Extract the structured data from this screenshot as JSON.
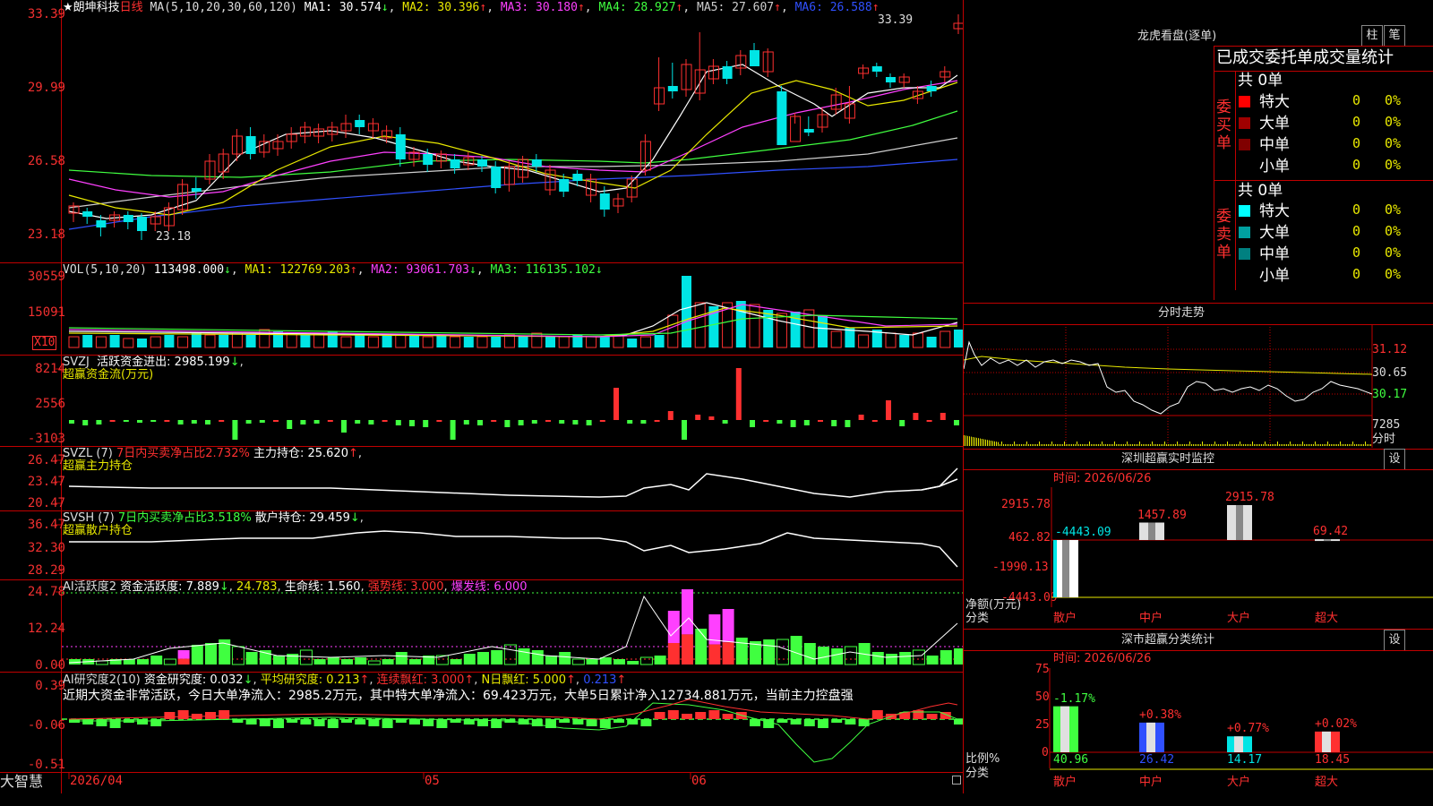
{
  "stock": {
    "name": "★朗坤科技",
    "period": "日线"
  },
  "ma": {
    "label": "MA(5,10,20,30,60,120)",
    "items": [
      {
        "text": "MA1: 30.574",
        "arrow": "↓",
        "color": "#ffffff"
      },
      {
        "text": "MA2: 30.396",
        "arrow": "↑",
        "color": "#e8e800"
      },
      {
        "text": "MA3: 30.180",
        "arrow": "↑",
        "color": "#ff40ff"
      },
      {
        "text": "MA4: 28.927",
        "arrow": "↑",
        "color": "#40ff40"
      },
      {
        "text": "MA5: 27.607",
        "arrow": "↑",
        "color": "#cfcfcf"
      },
      {
        "text": "MA6: 26.588",
        "arrow": "↑",
        "color": "#3050ff"
      }
    ],
    "high_label": "33.39",
    "low_label": "23.18"
  },
  "price_axis": [
    "33.39",
    "29.99",
    "26.58",
    "23.18"
  ],
  "vol": {
    "label": "VOL(5,10,20)",
    "value": "113498.000",
    "ma1": "MA1: 122769.203",
    "ma2": "MA2: 93061.703",
    "ma3": "MA3: 116135.102",
    "axis": [
      "30559",
      "15091"
    ],
    "unit": "X10"
  },
  "svzj": {
    "title": "SVZJ",
    "label": "活跃资金进出: 2985.199",
    "sub": "超赢资金流(万元)",
    "axis": [
      "8214",
      "2556",
      "-3103"
    ]
  },
  "svzl": {
    "title": "SVZL (7)",
    "pct": "7日内买卖净占比2.732%",
    "label": "主力持仓: 25.620",
    "sub": "超赢主力持仓",
    "axis": [
      "26.47",
      "23.47",
      "20.47"
    ]
  },
  "svsh": {
    "title": "SVSH (7)",
    "pct": "7日内买卖净占比3.518%",
    "label": "散户持仓: 29.459",
    "sub": "超赢散户持仓",
    "axis": [
      "36.47",
      "32.30",
      "28.29"
    ]
  },
  "ai_active": {
    "title": "AI活跃度2",
    "label": "资金活跃度: 7.889",
    "v2": "24.783",
    "life": "生命线: 1.560",
    "strong": "强势线: 3.000",
    "burst": "爆发线: 6.000",
    "axis": [
      "24.78",
      "12.24",
      "0.00"
    ]
  },
  "ai_research": {
    "title": "AI研究度2(10)",
    "label": "资金研究度: 0.032",
    "avg": "平均研究度: 0.213",
    "red": "连续飘红: 3.000",
    "nred": "N日飘红: 5.000",
    "last": "0.213",
    "summary": "近期大资金非常活跃，今日大单净流入：2985.2万元，其中特大单净流入：69.423万元，大单5日累计净入12734.881万元，当前主力控盘强",
    "axis": [
      "0.39",
      "-0.06",
      "-0.51"
    ]
  },
  "date_axis": [
    "2026/04",
    "05",
    "06"
  ],
  "brand": "大智慧",
  "panel": {
    "title": "龙虎看盘(逐单)",
    "btn1": "柱",
    "btn2": "笔",
    "header": "已成交委托单成交量统计",
    "buy_group": "委买单",
    "sell_group": "委卖单",
    "buy_total": "共 0单",
    "sell_total": "共 0单",
    "buy_rows": [
      {
        "label": "特大",
        "count": "0",
        "pct": "0%",
        "color": "#ff0000"
      },
      {
        "label": "大单",
        "count": "0",
        "pct": "0%",
        "color": "#a00000"
      },
      {
        "label": "中单",
        "count": "0",
        "pct": "0%",
        "color": "#800000"
      },
      {
        "label": "小单",
        "count": "0",
        "pct": "0%",
        "color": ""
      }
    ],
    "sell_rows": [
      {
        "label": "特大",
        "count": "0",
        "pct": "0%",
        "color": "#00ffff"
      },
      {
        "label": "大单",
        "count": "0",
        "pct": "0%",
        "color": "#00a0a0"
      },
      {
        "label": "中单",
        "count": "0",
        "pct": "0%",
        "color": "#008080"
      },
      {
        "label": "小单",
        "count": "0",
        "pct": "0%",
        "color": ""
      }
    ]
  },
  "intraday": {
    "title": "分时走势",
    "axis": [
      "31.12",
      "30.65",
      "30.17"
    ],
    "vol": "7285",
    "unit": "分时"
  },
  "sz_monitor": {
    "title": "深圳超赢实时监控",
    "btn": "设",
    "time": "时间: 2026/06/26",
    "axis": [
      "2915.78",
      "462.82",
      "-1990.13",
      "-4443.09"
    ],
    "ylabel": "净额(万元)",
    "xlabel": "分类",
    "categories": [
      "散户",
      "中户",
      "大户",
      "超大"
    ],
    "values": [
      "-4443.09",
      "1457.89",
      "2915.78",
      "69.42"
    ]
  },
  "sz_stats": {
    "title": "深市超赢分类统计",
    "btn": "设",
    "time": "时间: 2026/06/26",
    "axis": [
      "75",
      "50",
      "25",
      "0"
    ],
    "ylabel": "比例%",
    "xlabel": "分类",
    "categories": [
      "散户",
      "中户",
      "大户",
      "超大"
    ],
    "values": [
      "40.96",
      "26.42",
      "14.17",
      "18.45"
    ],
    "changes": [
      "-1.17%",
      "+0.38%",
      "+0.77%",
      "+0.02%"
    ]
  }
}
